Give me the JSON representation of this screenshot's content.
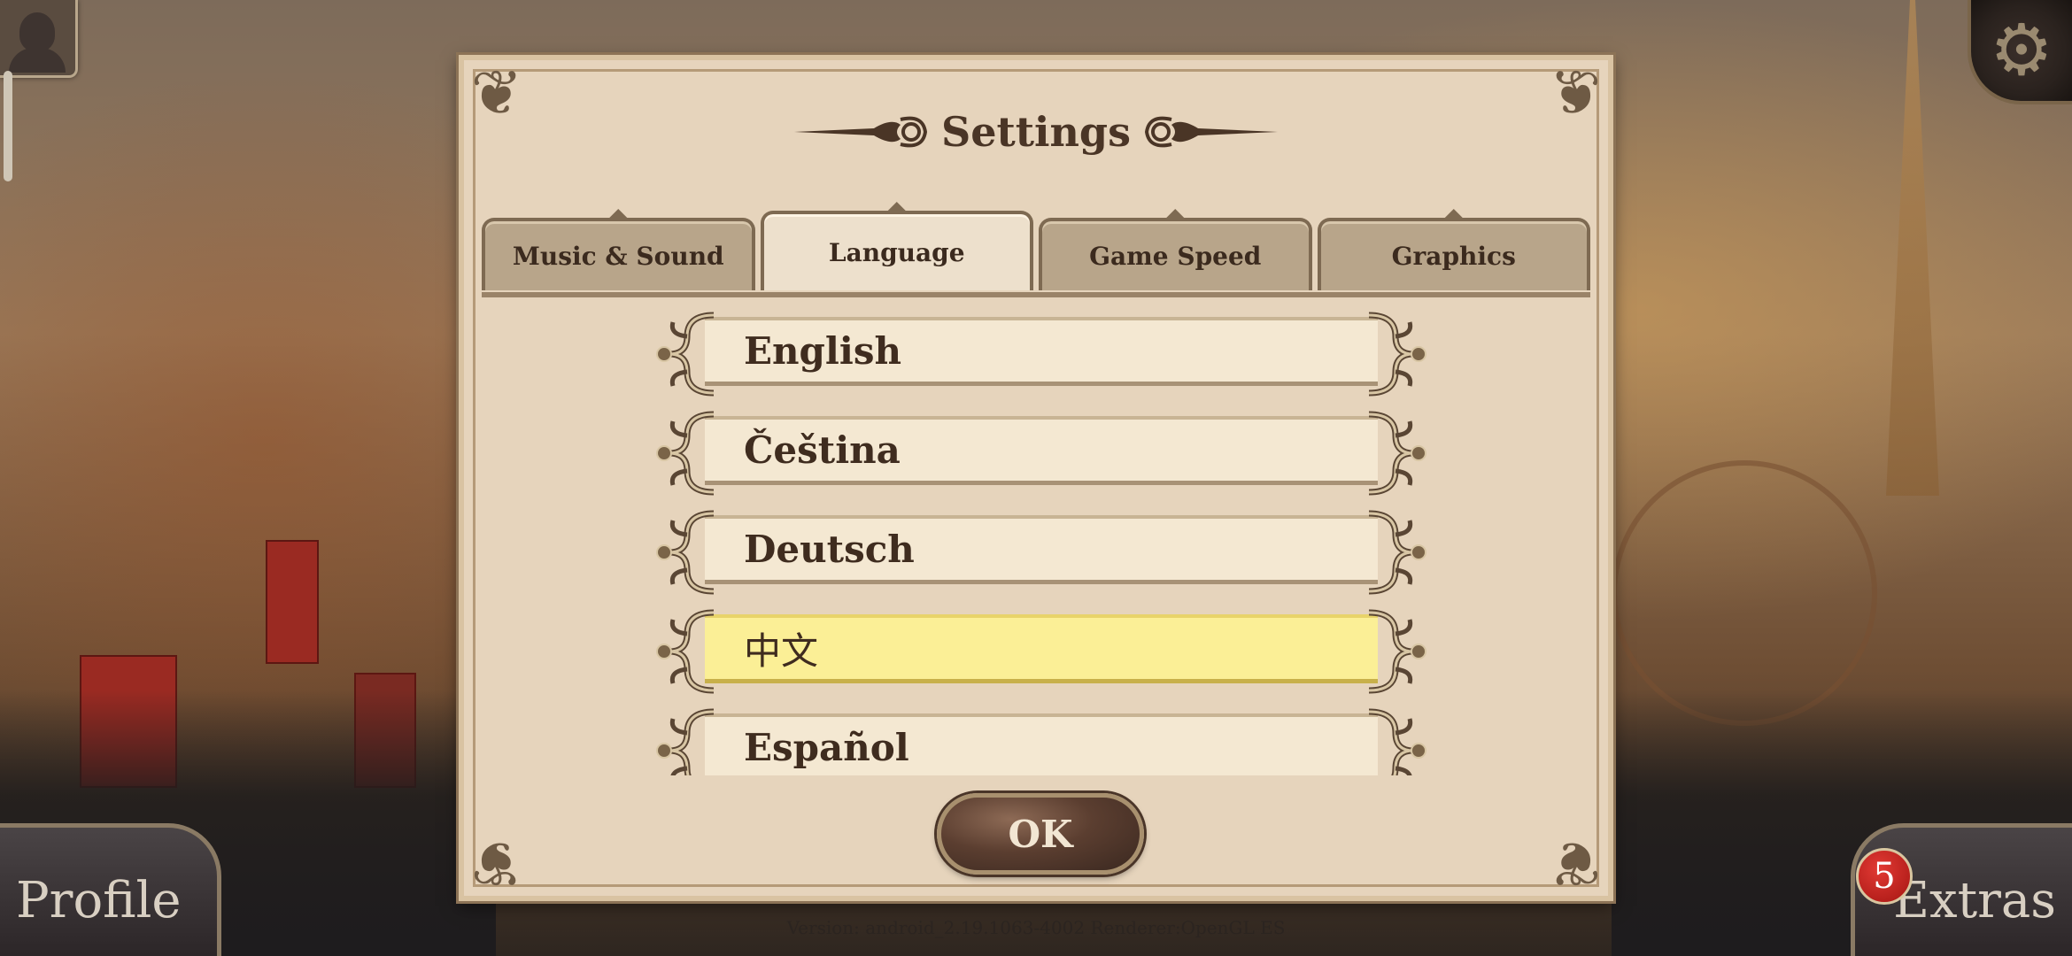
{
  "dialog": {
    "title": "Settings",
    "tabs": [
      {
        "label": "Music & Sound",
        "active": false
      },
      {
        "label": "Language",
        "active": true
      },
      {
        "label": "Game Speed",
        "active": false
      },
      {
        "label": "Graphics",
        "active": false
      }
    ],
    "languages": [
      {
        "label": "English",
        "selected": false
      },
      {
        "label": "Čeština",
        "selected": false
      },
      {
        "label": "Deutsch",
        "selected": false
      },
      {
        "label": "中文",
        "selected": true
      },
      {
        "label": "Español",
        "selected": false
      }
    ],
    "ok_label": "OK"
  },
  "hud": {
    "profile_label": "Profile",
    "extras_label": "Extras",
    "extras_badge": "5",
    "version": "Version: android_2.19.1063-4002 Renderer:OpenGL ES"
  },
  "colors": {
    "panel": "#e6d4bc",
    "selected_row": "#fbef96",
    "text_dark": "#3f2c1f"
  }
}
